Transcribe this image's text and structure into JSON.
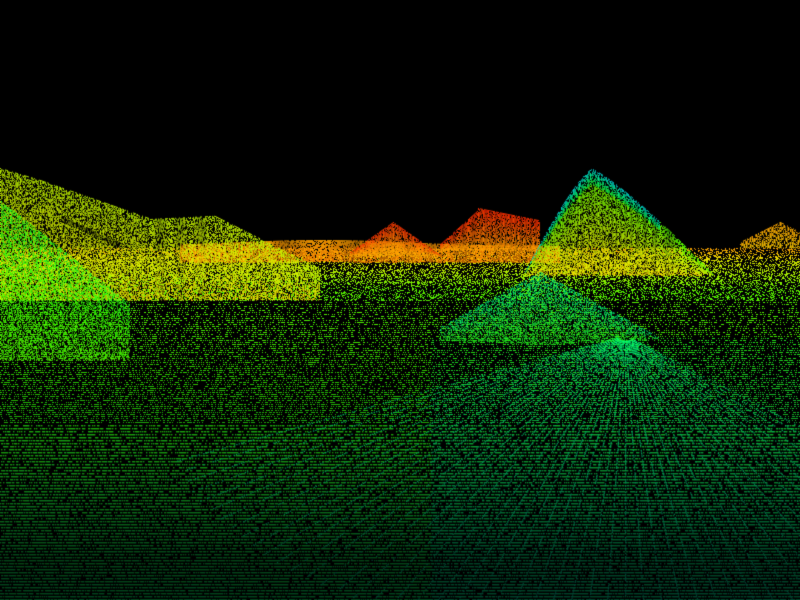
{
  "scene": {
    "kind": "lidar-point-cloud-terrain",
    "background_color": "#000000",
    "colormap": [
      "#00c8ff",
      "#00ff8a",
      "#33ff00",
      "#aaff00",
      "#ffe600",
      "#ff9a00",
      "#ff2a00"
    ],
    "color_encoding": "elevation",
    "visible_features": [
      "mountain-left",
      "mountain-right",
      "distant-peak-center",
      "distant-peak-right",
      "small-mound-center",
      "flat-valley-floor"
    ]
  }
}
